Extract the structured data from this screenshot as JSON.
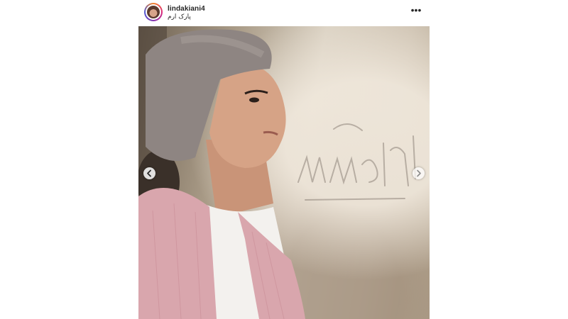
{
  "post": {
    "username": "lindakiani4",
    "location": "پارک ارم",
    "more_icon": "more-options-icon",
    "avatar_icon": "profile-avatar",
    "image_description_icon": "photo",
    "nav": {
      "prev_icon": "chevron-left-icon",
      "next_icon": "chevron-right-icon"
    }
  },
  "colors": {
    "text": "#262626",
    "story_ring": [
      "#f58529",
      "#dd2a7b",
      "#8134af",
      "#515bd4"
    ],
    "headscarf": "#8e8582",
    "vest": "#d9a6ad",
    "shirt": "#f3f1ee"
  }
}
